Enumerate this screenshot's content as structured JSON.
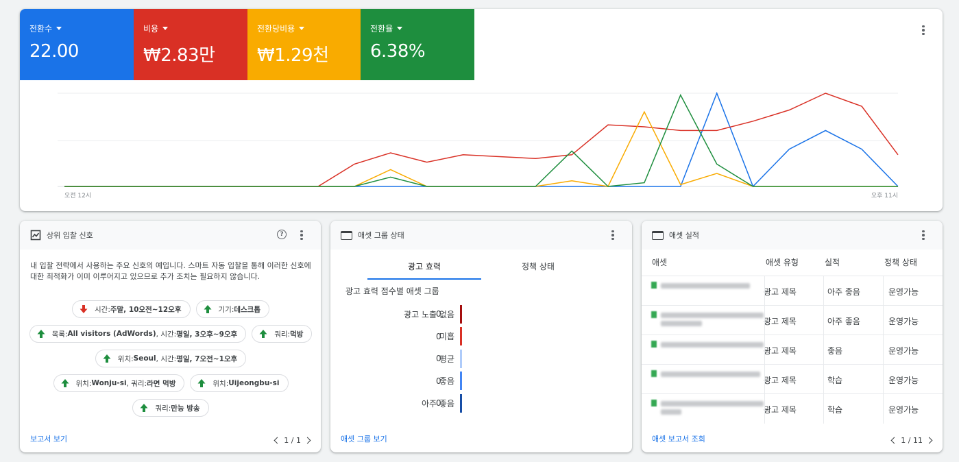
{
  "metrics": [
    {
      "label": "전환수",
      "value": "22.00",
      "color": "#1a73e8"
    },
    {
      "label": "비용",
      "value": "₩2.83만",
      "color": "#d93025"
    },
    {
      "label": "전환당비용",
      "value": "₩1.29천",
      "color": "#f9ab00"
    },
    {
      "label": "전환율",
      "value": "6.38%",
      "color": "#1e8e3e"
    }
  ],
  "chart_data": {
    "type": "line",
    "x_start_label": "오전 12시",
    "x_end_label": "오후 11시",
    "x": [
      0,
      1,
      2,
      3,
      4,
      5,
      6,
      7,
      8,
      9,
      10,
      11,
      12,
      13,
      14,
      15,
      16,
      17,
      18,
      19,
      20,
      21,
      22,
      23
    ],
    "grid": true,
    "series": [
      {
        "color": "#1a73e8",
        "values": [
          0,
          0,
          0,
          0,
          0,
          0,
          0,
          0,
          0,
          0,
          0,
          0,
          0,
          0,
          0,
          0,
          0,
          0,
          5,
          0,
          2,
          3,
          2,
          0
        ]
      },
      {
        "color": "#d93025",
        "values": [
          0,
          0,
          0,
          0,
          0,
          0,
          0,
          0,
          1.2,
          1.8,
          1.3,
          1.7,
          1.6,
          1.5,
          1.7,
          3.3,
          3.2,
          3.0,
          3.0,
          3.5,
          4.1,
          5.0,
          4.3,
          1.7
        ]
      },
      {
        "color": "#f9ab00",
        "values": [
          0,
          0,
          0,
          0,
          0,
          0,
          0,
          0,
          0,
          0.9,
          0,
          0,
          0,
          0,
          0.3,
          0,
          4.0,
          0.1,
          0.7,
          0,
          0,
          0,
          0,
          0
        ]
      },
      {
        "color": "#1e8e3e",
        "values": [
          0,
          0,
          0,
          0,
          0,
          0,
          0,
          0,
          0,
          0.5,
          0,
          0,
          0,
          0,
          1.9,
          0,
          0.2,
          4.9,
          1.2,
          0,
          0,
          0,
          0,
          0
        ]
      }
    ]
  },
  "panel1": {
    "title": "상위 입찰 신호",
    "description": "내 입찰 전략에서 사용하는 주요 신호의 예입니다. 스마트 자동 입찰을 통해 이러한 신호에 대한 최적화가 이미 이루어지고 있으므로 추가 조치는 필요하지 않습니다.",
    "chips": [
      {
        "dir": "down",
        "pre": "시간: ",
        "bold": "주말, 10오전~12오후",
        "post": ""
      },
      {
        "dir": "up",
        "pre": "기기: ",
        "bold": "데스크톱",
        "post": ""
      },
      {
        "dir": "up",
        "pre": "목록: ",
        "bold": "All visitors (AdWords)",
        "post": ", 시간: ",
        "bold2": "평일, 3오후~9오후"
      },
      {
        "dir": "up",
        "pre": "쿼리: ",
        "bold": "먹방",
        "post": ""
      },
      {
        "dir": "up",
        "pre": "위치: ",
        "bold": "Seoul",
        "post": ", 시간: ",
        "bold2": "평일, 7오전~1오후"
      },
      {
        "dir": "up",
        "pre": "위치: ",
        "bold": "Wonju-si",
        "post": ", 쿼리: ",
        "bold2": "라면 먹방"
      },
      {
        "dir": "up",
        "pre": "위치: ",
        "bold": "Uijeongbu-si",
        "post": ""
      },
      {
        "dir": "up",
        "pre": "쿼리: ",
        "bold": "만능 방송",
        "post": ""
      }
    ],
    "footer_link": "보고서 보기",
    "pager": "1 / 1"
  },
  "panel2": {
    "title": "애셋 그룹 상태",
    "tabs": [
      "광고 효력",
      "정책 상태"
    ],
    "subtitle": "광고 효력 점수별 애셋 그룹",
    "rows": [
      {
        "label": "광고 노출 없음",
        "value": "0",
        "color": "#a50e0e"
      },
      {
        "label": "미흡",
        "value": "0",
        "color": "#d93025"
      },
      {
        "label": "평균",
        "value": "0",
        "color": "#aecbfa"
      },
      {
        "label": "좋음",
        "value": "0",
        "color": "#4285f4"
      },
      {
        "label": "아주 좋음",
        "value": "0",
        "color": "#174ea6"
      }
    ],
    "footer_link": "애셋 그룹 보기"
  },
  "panel3": {
    "title": "애셋 실적",
    "headers": [
      "애셋",
      "애셋 유형",
      "실적",
      "정책 상태"
    ],
    "rows": [
      {
        "type": "광고 제목",
        "perf": "아주 좋음",
        "policy": "운영가능"
      },
      {
        "type": "광고 제목",
        "perf": "아주 좋음",
        "policy": "운영가능"
      },
      {
        "type": "광고 제목",
        "perf": "좋음",
        "policy": "운영가능"
      },
      {
        "type": "광고 제목",
        "perf": "학습",
        "policy": "운영가능"
      },
      {
        "type": "광고 제목",
        "perf": "학습",
        "policy": "운영가능"
      }
    ],
    "footer_link": "애셋 보고서 조회",
    "pager": "1 / 11"
  }
}
